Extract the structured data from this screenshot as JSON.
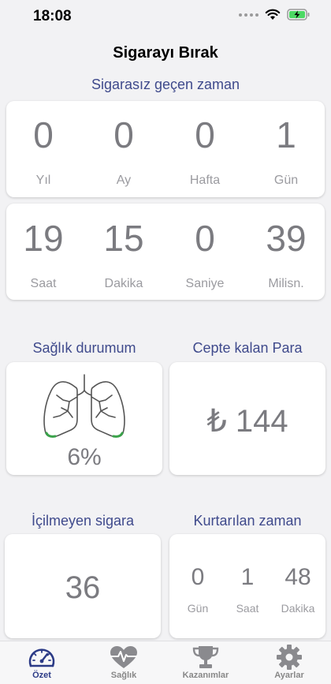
{
  "status": {
    "time": "18:08"
  },
  "header": {
    "title": "Sigarayı Bırak"
  },
  "smoke_free": {
    "title": "Sigarasız geçen zaman",
    "row1": [
      {
        "value": "0",
        "unit": "Yıl"
      },
      {
        "value": "0",
        "unit": "Ay"
      },
      {
        "value": "0",
        "unit": "Hafta"
      },
      {
        "value": "1",
        "unit": "Gün"
      }
    ],
    "row2": [
      {
        "value": "19",
        "unit": "Saat"
      },
      {
        "value": "15",
        "unit": "Dakika"
      },
      {
        "value": "0",
        "unit": "Saniye"
      },
      {
        "value": "39",
        "unit": "Milisn."
      }
    ]
  },
  "health": {
    "title": "Sağlık durumum",
    "percent_label": "6%",
    "progress": 0.06
  },
  "money": {
    "title": "Cepte kalan Para",
    "value": "₺ 144"
  },
  "cigarettes": {
    "title": "İçilmeyen sigara",
    "value": "36"
  },
  "saved_time": {
    "title": "Kurtarılan zaman",
    "items": [
      {
        "value": "0",
        "unit": "Gün"
      },
      {
        "value": "1",
        "unit": "Saat"
      },
      {
        "value": "48",
        "unit": "Dakika"
      }
    ]
  },
  "tabs": [
    {
      "label": "Özet",
      "icon": "gauge-icon",
      "active": true
    },
    {
      "label": "Sağlık",
      "icon": "heart-pulse-icon",
      "active": false
    },
    {
      "label": "Kazanımlar",
      "icon": "trophy-icon",
      "active": false
    },
    {
      "label": "Ayarlar",
      "icon": "gear-icon",
      "active": false
    }
  ],
  "colors": {
    "accent": "#2b3a86",
    "section_title": "#3f4a8c",
    "number": "#7b7b80",
    "lung_progress": "#3aa34a",
    "battery": "#4cd964"
  }
}
